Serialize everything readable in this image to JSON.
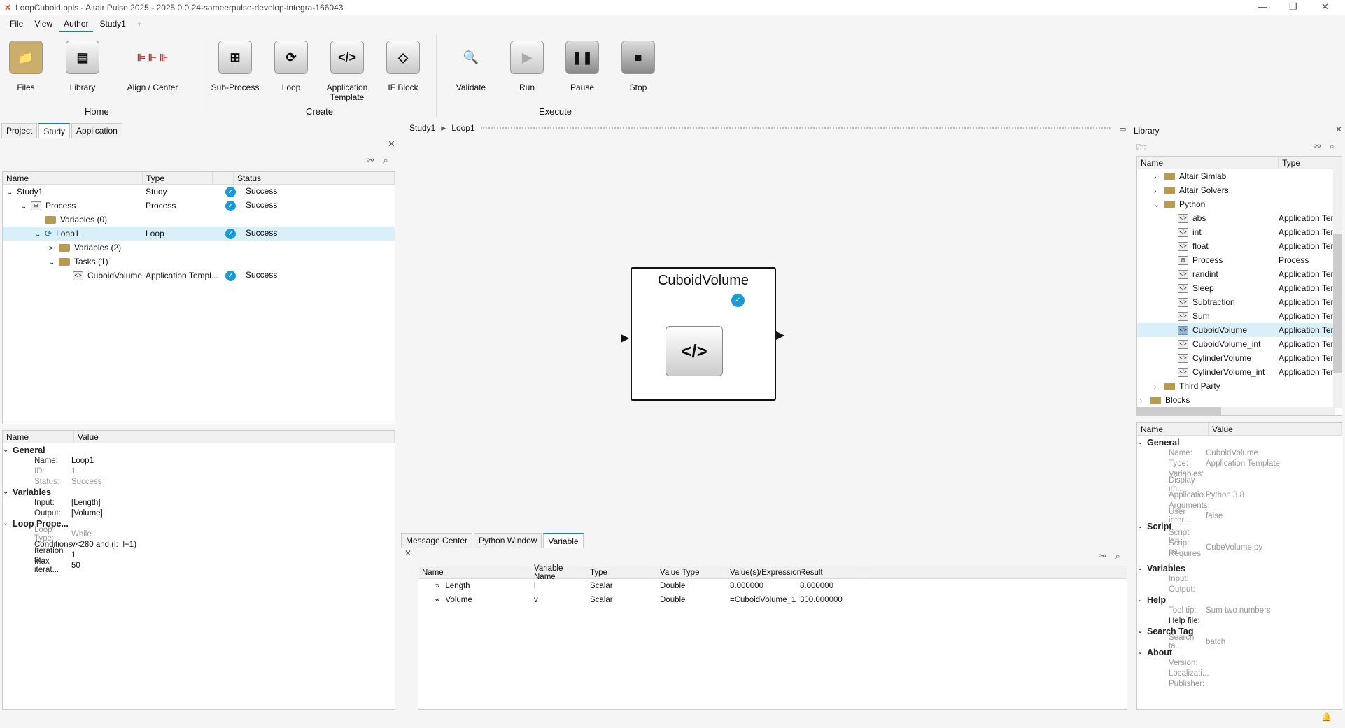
{
  "window": {
    "title": "LoopCuboid.ppls - Altair Pulse 2025 - 2025.0.0.24-sameerpulse-develop-integra-166043"
  },
  "menu": [
    "File",
    "View",
    "Author",
    "Study1",
    "+"
  ],
  "ribbon": {
    "home": {
      "label": "Home",
      "buttons": [
        "Files",
        "Library",
        "Align / Center"
      ]
    },
    "create": {
      "label": "Create",
      "buttons": [
        "Sub-Process",
        "Loop",
        "Application Template",
        "IF Block"
      ]
    },
    "execute": {
      "label": "Execute",
      "buttons": [
        "Validate",
        "Run",
        "Pause",
        "Stop"
      ]
    }
  },
  "left_tabs": [
    "Project",
    "Study",
    "Application"
  ],
  "breadcrumb": [
    "Study1",
    "Loop1"
  ],
  "study_tree": {
    "columns": [
      "Name",
      "Type",
      "",
      "Status"
    ],
    "rows": [
      {
        "name": "Study1",
        "type": "Study",
        "status": "Success"
      },
      {
        "name": "Process",
        "type": "Process",
        "status": "Success"
      },
      {
        "name": "Variables (0)",
        "type": "",
        "status": ""
      },
      {
        "name": "Loop1",
        "type": "Loop",
        "status": "Success"
      },
      {
        "name": "Variables (2)",
        "type": "",
        "status": ""
      },
      {
        "name": "Tasks (1)",
        "type": "",
        "status": ""
      },
      {
        "name": "CuboidVolume",
        "type": "Application Templ...",
        "status": "Success"
      }
    ]
  },
  "loop_props": {
    "columns": [
      "Name",
      "Value"
    ],
    "groups": [
      {
        "name": "General",
        "items": [
          [
            "Name:",
            "Loop1"
          ],
          [
            "ID:",
            "1"
          ],
          [
            "Status:",
            "Success"
          ]
        ]
      },
      {
        "name": "Variables",
        "items": [
          [
            "Input:",
            "[Length]"
          ],
          [
            "Output:",
            "[Volume]"
          ]
        ]
      },
      {
        "name": "Loop Prope...",
        "items": [
          [
            "Loop Type:",
            "While"
          ],
          [
            "Conditions:",
            "v<280 and (l:=l+1)"
          ],
          [
            "Iteration s...",
            "1"
          ],
          [
            "Max iterat...",
            "50"
          ]
        ]
      }
    ]
  },
  "canvas": {
    "node_title": "CuboidVolume",
    "node_icon": "</>"
  },
  "bottom_tabs": [
    "Message Center",
    "Python Window",
    "Variable"
  ],
  "variables": {
    "columns": [
      "Name",
      "Variable Name",
      "Type",
      "Value Type",
      "Value(s)/Expression",
      "Result"
    ],
    "rows": [
      {
        "dir": "»",
        "name": "Length",
        "var": "l",
        "type": "Scalar",
        "vtype": "Double",
        "expr": "8.000000",
        "result": "8.000000"
      },
      {
        "dir": "«",
        "name": "Volume",
        "var": "v",
        "type": "Scalar",
        "vtype": "Double",
        "expr": "=CuboidVolume_1...",
        "result": "300.000000"
      }
    ]
  },
  "library": {
    "title": "Library",
    "columns": [
      "Name",
      "Type"
    ],
    "items": [
      {
        "name": "Altair Simlab",
        "type": "",
        "lvl": 1,
        "kind": "folder",
        "exp": ">"
      },
      {
        "name": "Altair Solvers",
        "type": "",
        "lvl": 1,
        "kind": "folder",
        "exp": ">"
      },
      {
        "name": "Python",
        "type": "",
        "lvl": 1,
        "kind": "folder",
        "exp": "v"
      },
      {
        "name": "abs",
        "type": "Application Temp",
        "lvl": 2,
        "kind": "app"
      },
      {
        "name": "int",
        "type": "Application Temp",
        "lvl": 2,
        "kind": "app"
      },
      {
        "name": "float",
        "type": "Application Temp",
        "lvl": 2,
        "kind": "app"
      },
      {
        "name": "Process",
        "type": "Process",
        "lvl": 2,
        "kind": "app"
      },
      {
        "name": "randint",
        "type": "Application Temp",
        "lvl": 2,
        "kind": "app"
      },
      {
        "name": "Sleep",
        "type": "Application Temp",
        "lvl": 2,
        "kind": "app"
      },
      {
        "name": "Subtraction",
        "type": "Application Temp",
        "lvl": 2,
        "kind": "app"
      },
      {
        "name": "Sum",
        "type": "Application Temp",
        "lvl": 2,
        "kind": "app"
      },
      {
        "name": "CuboidVolume",
        "type": "Application Temp",
        "lvl": 2,
        "kind": "app",
        "sel": true
      },
      {
        "name": "CuboidVolume_int",
        "type": "Application Temp",
        "lvl": 2,
        "kind": "app"
      },
      {
        "name": "CylinderVolume",
        "type": "Application Temp",
        "lvl": 2,
        "kind": "app"
      },
      {
        "name": "CylinderVolume_int",
        "type": "Application Temp",
        "lvl": 2,
        "kind": "app"
      },
      {
        "name": "Third Party",
        "type": "",
        "lvl": 1,
        "kind": "folder",
        "exp": ">"
      },
      {
        "name": "Blocks",
        "type": "",
        "lvl": 0,
        "kind": "folder",
        "exp": ">"
      }
    ]
  },
  "lib_props": {
    "columns": [
      "Name",
      "Value"
    ],
    "groups": [
      {
        "name": "General",
        "items": [
          [
            "Name:",
            "CuboidVolume"
          ],
          [
            "Type:",
            "Application Template"
          ],
          [
            "Variables:",
            ""
          ],
          [
            "Display im...",
            ""
          ],
          [
            "Applicatio...",
            "Python 3.8"
          ],
          [
            "Arguments:",
            ""
          ],
          [
            "User inter...",
            "false"
          ]
        ]
      },
      {
        "name": "Script",
        "items": [
          [
            "Script lan...",
            ""
          ],
          [
            "Script na...",
            "CubeVolume.py"
          ],
          [
            "Requires ...",
            ""
          ]
        ]
      },
      {
        "name": "Variables",
        "items": [
          [
            "Input:",
            ""
          ],
          [
            "Output:",
            ""
          ]
        ]
      },
      {
        "name": "Help",
        "items": [
          [
            "Tool tip:",
            "Sum two numbers"
          ],
          [
            "Help file:",
            ""
          ]
        ]
      },
      {
        "name": "Search Tag",
        "items": [
          [
            "Search ta...",
            "batch"
          ]
        ]
      },
      {
        "name": "About",
        "items": [
          [
            "Version:",
            ""
          ],
          [
            "Localizati...",
            ""
          ],
          [
            "Publisher:",
            ""
          ]
        ]
      }
    ]
  }
}
